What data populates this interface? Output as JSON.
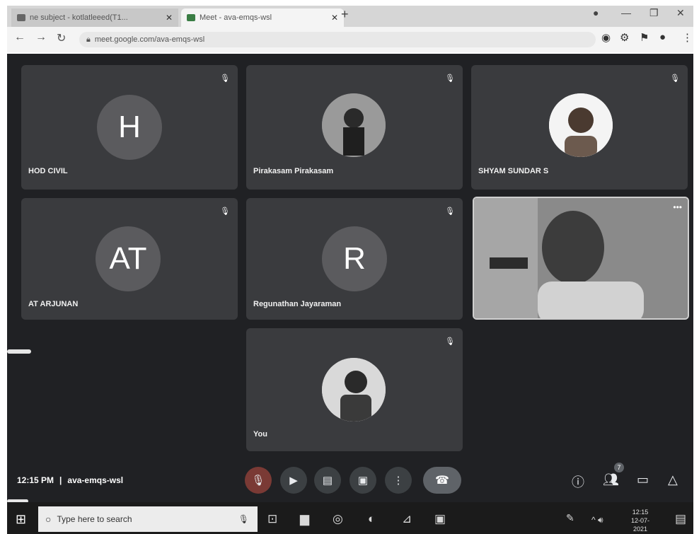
{
  "browser": {
    "tabs": [
      {
        "label": "ne subject - kotlatleeed(T1...",
        "active": false
      },
      {
        "label": "Meet - ava-emqs-wsl",
        "active": true
      }
    ],
    "new_tab": "+",
    "url": "meet.google.com/ava-emqs-wsl",
    "window_controls": [
      "—",
      "❐",
      "✕"
    ]
  },
  "meet": {
    "participants": [
      {
        "name": "HOD CIVIL",
        "initials": "H",
        "avatar": "letter",
        "muted": true
      },
      {
        "name": "Pirakasam Pirakasam",
        "initials": "",
        "avatar": "photo",
        "muted": true
      },
      {
        "name": "SHYAM SUNDAR S",
        "initials": "",
        "avatar": "photo",
        "muted": true
      },
      {
        "name": "AT ARJUNAN",
        "initials": "AT",
        "avatar": "letter",
        "muted": true
      },
      {
        "name": "Regunathan Jayaraman",
        "initials": "R",
        "avatar": "letter",
        "muted": true
      },
      {
        "name": "",
        "initials": "",
        "avatar": "video",
        "muted": false
      },
      {
        "name": "You",
        "initials": "",
        "avatar": "photo",
        "muted": true
      }
    ],
    "footer": {
      "time": "12:15 PM",
      "separator": "|",
      "meeting_code": "ava-emqs-wsl"
    },
    "participant_count": "7"
  },
  "taskbar": {
    "search_placeholder": "Type here to search",
    "clock_time": "12:15",
    "clock_date": "12-07-2021"
  },
  "colors": {
    "meet_bg": "#202124",
    "tile_bg": "#3a3b3e",
    "taskbar_bg": "#1b1b1b"
  }
}
